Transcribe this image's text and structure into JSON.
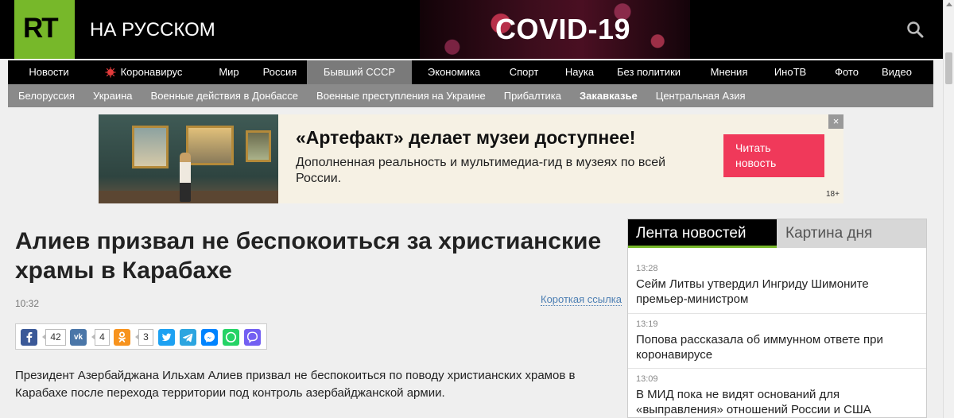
{
  "header": {
    "logo": "RT",
    "brand": "НА РУССКОМ",
    "promo": "COVID-19",
    "search_icon": "search-icon"
  },
  "nav": {
    "items": [
      {
        "label": "Новости"
      },
      {
        "label": "Коронавирус",
        "icon": "virus-icon"
      },
      {
        "label": "Мир"
      },
      {
        "label": "Россия"
      },
      {
        "label": "Бывший СССР",
        "active": true
      },
      {
        "label": "Экономика"
      },
      {
        "label": "Спорт"
      },
      {
        "label": "Наука"
      },
      {
        "label": "Без политики"
      },
      {
        "label": "Мнения"
      },
      {
        "label": "ИноТВ"
      },
      {
        "label": "Фото"
      },
      {
        "label": "Видео"
      }
    ]
  },
  "subnav": {
    "items": [
      {
        "label": "Белоруссия"
      },
      {
        "label": "Украина"
      },
      {
        "label": "Военные действия в Донбассе"
      },
      {
        "label": "Военные преступления на Украине"
      },
      {
        "label": "Прибалтика"
      },
      {
        "label": "Закавказье",
        "current": true
      },
      {
        "label": "Центральная Азия"
      }
    ]
  },
  "ad": {
    "title": "«Артефакт» делает музеи доступнее!",
    "text": "Дополненная реальность и мультимедиа-гид в музеях по всей России.",
    "button_line1": "Читать",
    "button_line2": "новость",
    "close": "×",
    "age": "18+"
  },
  "article": {
    "title": "Алиев призвал не беспокоиться за христианские храмы в Карабахе",
    "time": "10:32",
    "short_link": "Короткая ссылка",
    "lead": "Президент Азербайджана Ильхам Алиев призвал не беспокоиться по поводу христианских храмов в Карабахе после перехода территории под контроль азербайджанской армии."
  },
  "share": {
    "facebook": {
      "icon": "f",
      "count": "42",
      "color": "#3b5998"
    },
    "vk": {
      "icon": "vk",
      "count": "4",
      "color": "#4a76a8"
    },
    "ok": {
      "icon": "ok",
      "count": "3",
      "color": "#f7931e"
    },
    "twitter": {
      "icon": "t",
      "color": "#1da1f2"
    },
    "telegram": {
      "icon": "tg",
      "color": "#2ca5e0"
    },
    "messenger": {
      "icon": "m",
      "color": "#0084ff"
    },
    "whatsapp": {
      "icon": "w",
      "color": "#25d366"
    },
    "viber": {
      "icon": "v",
      "color": "#7360f2"
    }
  },
  "sidebar": {
    "tab_feed": "Лента новостей",
    "tab_day": "Картина дня",
    "news": [
      {
        "time": "13:28",
        "headline": "Сейм Литвы утвердил Ингриду Шимоните премьер-министром"
      },
      {
        "time": "13:19",
        "headline": "Попова рассказала об иммунном ответе при коронавирусе"
      },
      {
        "time": "13:09",
        "headline": "В МИД пока не видят оснований для «выправления» отношений России и США"
      }
    ]
  }
}
